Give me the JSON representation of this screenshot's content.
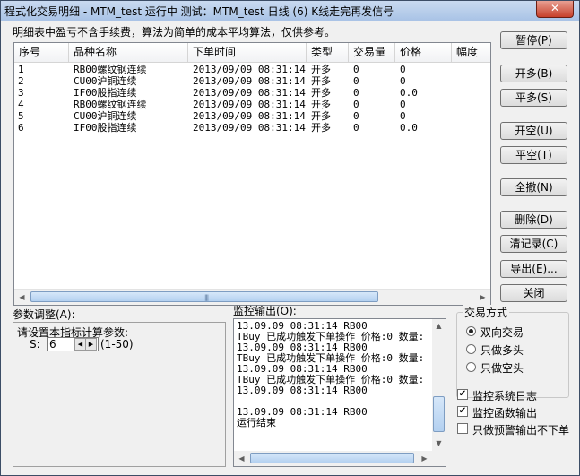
{
  "window": {
    "title": "程式化交易明细 - MTM_test 运行中  测试：MTM_test 日线 (6) K线走完再发信号",
    "close_glyph": "✕"
  },
  "note": "明细表中盈亏不含手续费，算法为简单的成本平均算法，仅供参考。",
  "table": {
    "columns": [
      "序号",
      "品种名称",
      "下单时间",
      "类型",
      "交易量",
      "价格",
      "幅度"
    ],
    "rows": [
      [
        "1",
        "RB00螺纹钢连续",
        "2013/09/09 08:31:14",
        "开多",
        "0",
        "0",
        ""
      ],
      [
        "2",
        "CU00沪铜连续",
        "2013/09/09 08:31:14",
        "开多",
        "0",
        "0",
        ""
      ],
      [
        "3",
        "IF00股指连续",
        "2013/09/09 08:31:14",
        "开多",
        "0",
        "0.0",
        ""
      ],
      [
        "4",
        "RB00螺纹钢连续",
        "2013/09/09 08:31:14",
        "开多",
        "0",
        "0",
        ""
      ],
      [
        "5",
        "CU00沪铜连续",
        "2013/09/09 08:31:14",
        "开多",
        "0",
        "0",
        ""
      ],
      [
        "6",
        "IF00股指连续",
        "2013/09/09 08:31:14",
        "开多",
        "0",
        "0.0",
        ""
      ]
    ]
  },
  "buttons": {
    "pause": "暂停(P)",
    "open_long": "开多(B)",
    "close_long": "平多(S)",
    "open_short": "开空(U)",
    "close_short": "平空(T)",
    "cancel_all": "全撤(N)",
    "delete": "删除(D)",
    "clear_records": "清记录(C)",
    "export": "导出(E)...",
    "close": "关闭"
  },
  "params": {
    "label": "参数调整(A):",
    "prompt": "请设置本指标计算参数:",
    "s_label": "S:",
    "s_value": "6",
    "range": "(1-50)"
  },
  "monitor": {
    "label": "监控输出(O):",
    "lines": [
      "13.09.09 08:31:14 RB00",
      "TBuy 已成功触发下单操作 价格:0 数量:",
      "13.09.09 08:31:14 RB00",
      "TBuy 已成功触发下单操作 价格:0 数量:",
      "13.09.09 08:31:14 RB00",
      "TBuy 已成功触发下单操作 价格:0 数量:",
      "13.09.09 08:31:14 RB00",
      "",
      "13.09.09 08:31:14 RB00",
      "运行结束"
    ]
  },
  "trade_mode": {
    "legend": "交易方式",
    "options": [
      "双向交易",
      "只做多头",
      "只做空头"
    ],
    "selected": "双向交易"
  },
  "checkboxes": {
    "monitor_log": "监控系统日志",
    "monitor_func": "监控函数输出",
    "alert_only": "只做预警输出不下单"
  }
}
